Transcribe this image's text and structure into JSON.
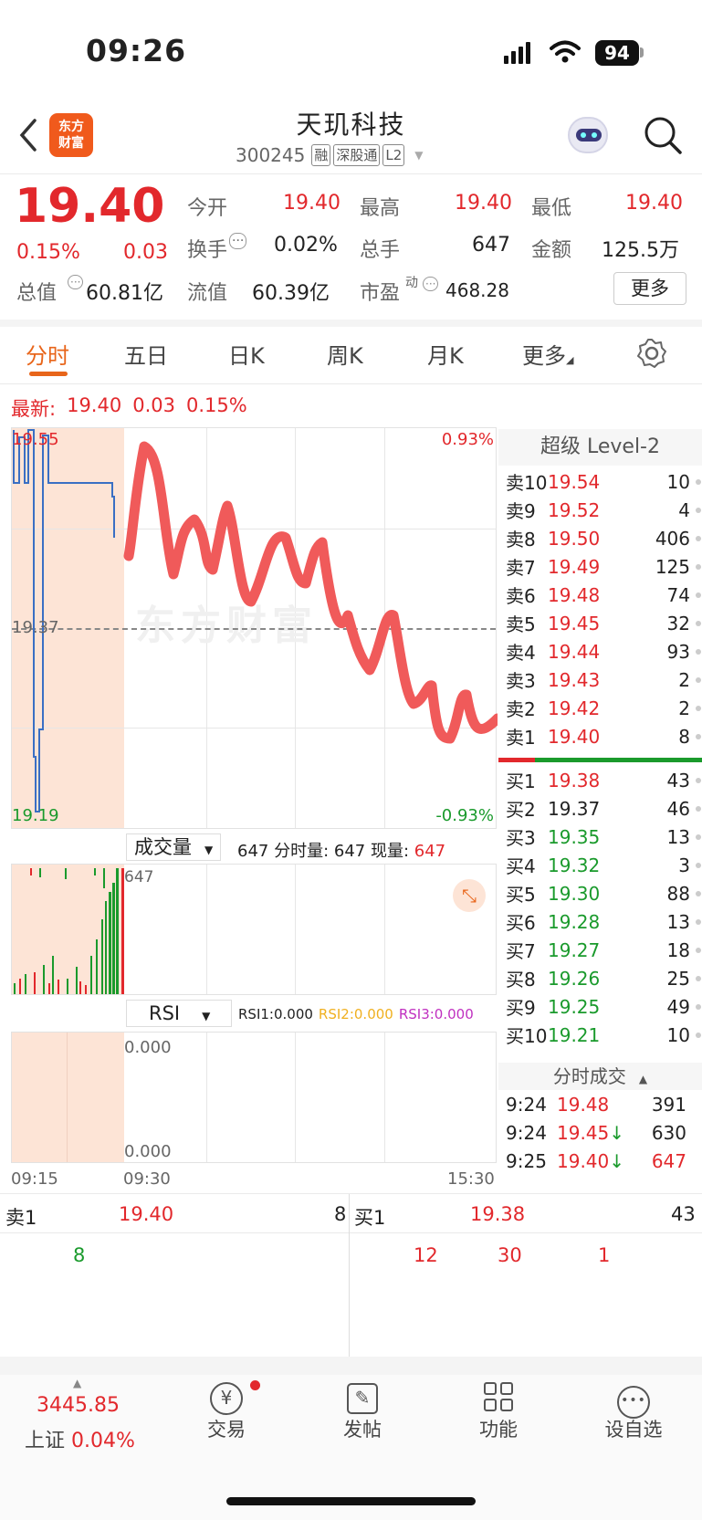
{
  "status_bar": {
    "time": "09:26",
    "battery": "94"
  },
  "header": {
    "logo_text": "东方\n财富",
    "stock_name": "天玑科技",
    "stock_code": "300245",
    "tags": [
      "融",
      "深股通",
      "L2"
    ]
  },
  "quote": {
    "price": "19.40",
    "change_pct": "0.15%",
    "change": "0.03",
    "total_value_label": "总值",
    "total_value": "60.81亿",
    "float_value_label": "流值",
    "float_value": "60.39亿",
    "pe_label": "市盈",
    "pe_sup": "动",
    "pe": "468.28",
    "open_label": "今开",
    "open": "19.40",
    "high_label": "最高",
    "high": "19.40",
    "low_label": "最低",
    "low": "19.40",
    "turnover_label": "换手",
    "turnover": "0.02%",
    "volume_label": "总手",
    "volume": "647",
    "amount_label": "金额",
    "amount": "125.5万",
    "more_label": "更多"
  },
  "tabs": [
    "分时",
    "五日",
    "日K",
    "周K",
    "月K",
    "更多"
  ],
  "latest": {
    "label": "最新:",
    "price": "19.40",
    "change": "0.03",
    "pct": "0.15%"
  },
  "intraday": {
    "y_high": "19.55",
    "y_mid": "19.37",
    "y_low": "19.19",
    "pct_high": "0.93%",
    "pct_low": "-0.93%",
    "watermark": "东方财富"
  },
  "volume_panel": {
    "selector": "成交量",
    "summary": "647 分时量: 647 现量:",
    "current": "647",
    "max_label": "647"
  },
  "rsi_panel": {
    "selector": "RSI",
    "rsi1": "RSI1:0.000",
    "rsi2": "RSI2:0.000",
    "rsi3": "RSI3:0.000",
    "top": "0.000",
    "bottom": "0.000"
  },
  "time_axis": {
    "t1": "09:15",
    "t2": "09:30",
    "t3": "15:30"
  },
  "level2": {
    "title": "超级 Level-2",
    "asks": [
      {
        "label": "卖10",
        "price": "19.54",
        "vol": "10"
      },
      {
        "label": "卖9",
        "price": "19.52",
        "vol": "4"
      },
      {
        "label": "卖8",
        "price": "19.50",
        "vol": "406"
      },
      {
        "label": "卖7",
        "price": "19.49",
        "vol": "125"
      },
      {
        "label": "卖6",
        "price": "19.48",
        "vol": "74"
      },
      {
        "label": "卖5",
        "price": "19.45",
        "vol": "32"
      },
      {
        "label": "卖4",
        "price": "19.44",
        "vol": "93"
      },
      {
        "label": "卖3",
        "price": "19.43",
        "vol": "2"
      },
      {
        "label": "卖2",
        "price": "19.42",
        "vol": "2"
      },
      {
        "label": "卖1",
        "price": "19.40",
        "vol": "8"
      }
    ],
    "bids": [
      {
        "label": "买1",
        "price": "19.38",
        "vol": "43"
      },
      {
        "label": "买2",
        "price": "19.37",
        "vol": "46"
      },
      {
        "label": "买3",
        "price": "19.35",
        "vol": "13"
      },
      {
        "label": "买4",
        "price": "19.32",
        "vol": "3"
      },
      {
        "label": "买5",
        "price": "19.30",
        "vol": "88"
      },
      {
        "label": "买6",
        "price": "19.28",
        "vol": "13"
      },
      {
        "label": "买7",
        "price": "19.27",
        "vol": "18"
      },
      {
        "label": "买8",
        "price": "19.26",
        "vol": "25"
      },
      {
        "label": "买9",
        "price": "19.25",
        "vol": "49"
      },
      {
        "label": "买10",
        "price": "19.21",
        "vol": "10"
      }
    ],
    "ticks_title": "分时成交",
    "ticks": [
      {
        "time": "9:24",
        "price": "19.48",
        "vol": "391"
      },
      {
        "time": "9:24",
        "price": "19.45↓",
        "vol": "630"
      },
      {
        "time": "9:25",
        "price": "19.40↓",
        "vol": "647"
      }
    ]
  },
  "queue": {
    "ask_label": "卖1",
    "ask_price": "19.40",
    "ask_vol": "8",
    "bid_label": "买1",
    "bid_price": "19.38",
    "bid_vol": "43",
    "ask_orders": [
      "8"
    ],
    "bid_orders": [
      "12",
      "30",
      "1"
    ]
  },
  "bottom_nav": {
    "index_value": "3445.85",
    "index_name": "上证",
    "index_pct": "0.04%",
    "trade": "交易",
    "post": "发帖",
    "functions": "功能",
    "watchlist": "设自选"
  }
}
